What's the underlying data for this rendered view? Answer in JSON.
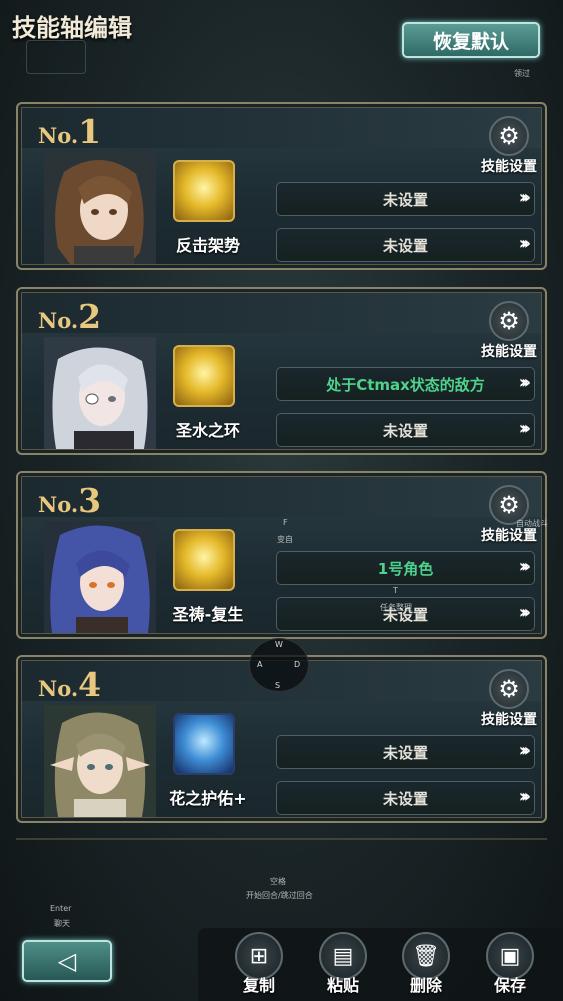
{
  "header": {
    "title": "技能轴编辑",
    "restore_label": "恢复默认",
    "hint_skip": "领过"
  },
  "cards": [
    {
      "num_prefix": "No.",
      "num": "1",
      "settings_label": "技能设置",
      "skill_name": "反击架势",
      "slot_a": "未设置",
      "slot_b": "未设置",
      "chevron": "›››"
    },
    {
      "num_prefix": "No.",
      "num": "2",
      "settings_label": "技能设置",
      "skill_name": "圣水之环",
      "slot_a": "处于Ctmax状态的敌方",
      "slot_b": "未设置",
      "chevron": "›››"
    },
    {
      "num_prefix": "No.",
      "num": "3",
      "settings_label": "技能设置",
      "skill_name": "圣祷-复生",
      "slot_a": "1号角色",
      "slot_b": "未设置",
      "chevron": "›››"
    },
    {
      "num_prefix": "No.",
      "num": "4",
      "settings_label": "技能设置",
      "skill_name": "花之护佑+",
      "slot_a": "未设置",
      "slot_b": "未设置",
      "chevron": "›››"
    }
  ],
  "overlay_hints": {
    "f_key": "F",
    "f_label": "变自",
    "auto_battle": "自动战斗",
    "t_key": "T",
    "t_label": "任务整理",
    "dpad_w": "W",
    "dpad_a": "A",
    "dpad_s": "S",
    "dpad_d": "D",
    "space_key": "空格",
    "space_label": "开始回合/跳过回合",
    "enter_key": "Enter",
    "enter_label": "聊天"
  },
  "bottom": {
    "back_icon": "back-arrow-icon",
    "actions": [
      {
        "label": "复制",
        "icon": "copy-icon"
      },
      {
        "label": "粘贴",
        "icon": "paste-icon"
      },
      {
        "label": "删除",
        "icon": "trash-icon"
      },
      {
        "label": "保存",
        "icon": "save-icon"
      }
    ]
  },
  "colors": {
    "accent_teal": "#5c9c95",
    "gold": "#e8c77f",
    "green_text": "#4fd28c"
  }
}
